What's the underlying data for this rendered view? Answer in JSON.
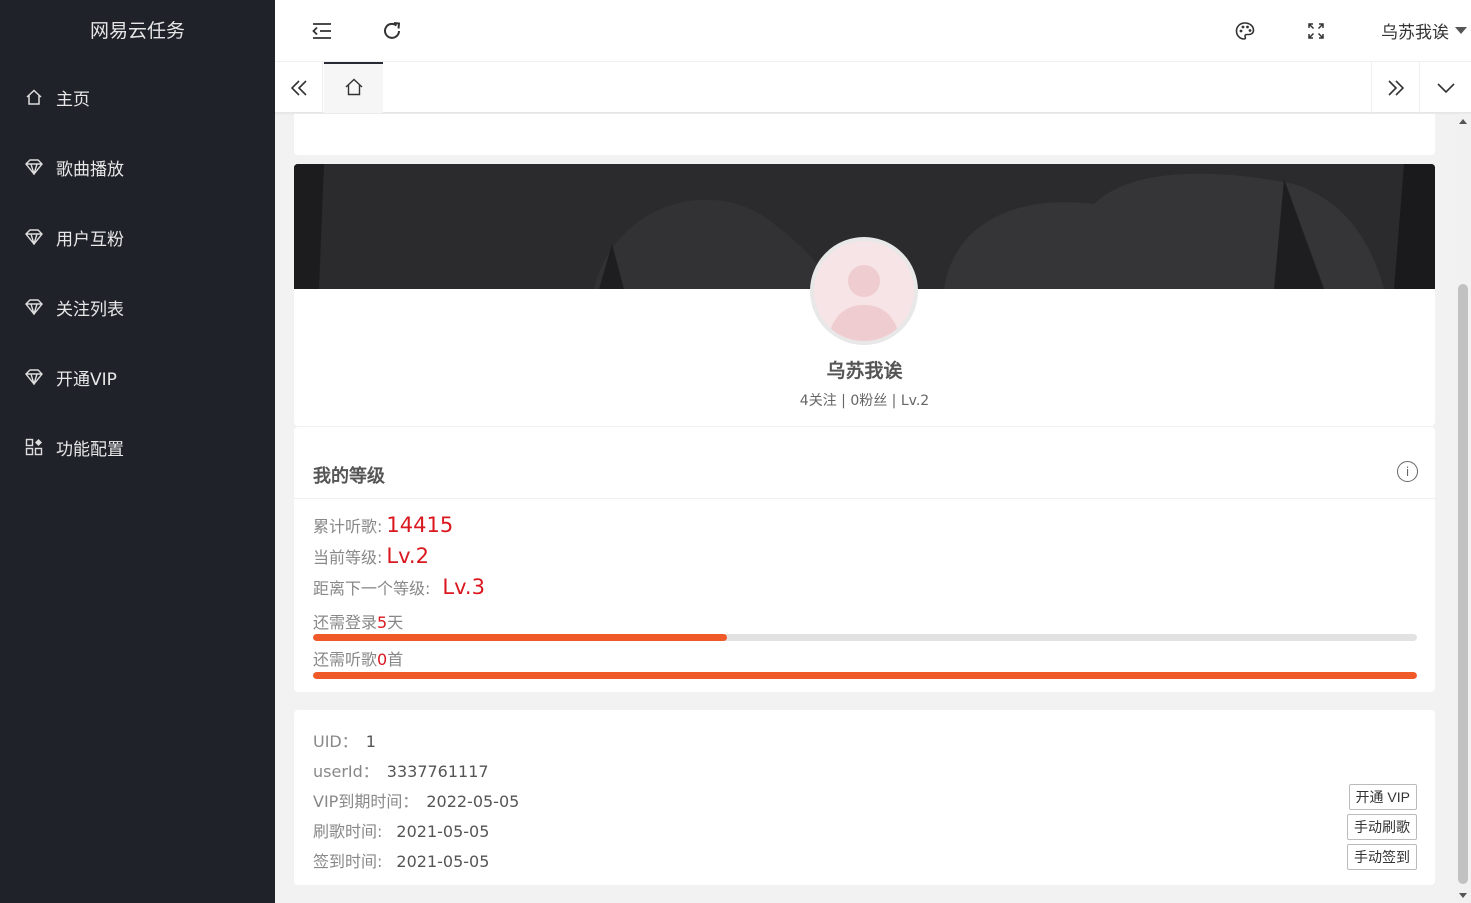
{
  "app": {
    "title": "网易云任务"
  },
  "sidebar": {
    "items": [
      {
        "label": "主页",
        "icon": "home-icon"
      },
      {
        "label": "歌曲播放",
        "icon": "diamond-icon"
      },
      {
        "label": "用户互粉",
        "icon": "diamond-icon"
      },
      {
        "label": "关注列表",
        "icon": "diamond-icon"
      },
      {
        "label": "开通VIP",
        "icon": "diamond-icon"
      },
      {
        "label": "功能配置",
        "icon": "apps-icon"
      }
    ]
  },
  "header": {
    "username": "乌苏我诶",
    "icons": [
      "menu-collapse-icon",
      "refresh-icon",
      "palette-icon",
      "fullscreen-icon"
    ]
  },
  "profile": {
    "name": "乌苏我诶",
    "stats": "4关注 | 0粉丝 | Lv.2"
  },
  "level": {
    "title": "我的等级",
    "total_label": "累计听歌:",
    "total_value": "14415",
    "current_label": "当前等级:",
    "current_value": "Lv.2",
    "next_label": "距离下一个等级:",
    "next_value": "Lv.3",
    "login_prefix": "还需登录",
    "login_days": "5",
    "login_suffix": "天",
    "login_progress": 0.375,
    "listen_prefix": "还需听歌",
    "listen_count": "0",
    "listen_suffix": "首",
    "listen_progress": 1.0
  },
  "detail": {
    "uid_label": "UID：",
    "uid_value": "1",
    "userid_label": "userId：",
    "userid_value": "3337761117",
    "vip_label": "VIP到期时间：",
    "vip_value": "2022-05-05",
    "refresh_label": "刷歌时间:",
    "refresh_value": "2021-05-05",
    "signin_label": "签到时间:",
    "signin_value": "2021-05-05",
    "btn_vip": "开通 VIP",
    "btn_refresh": "手动刷歌",
    "btn_signin": "手动签到"
  },
  "colors": {
    "sidebar": "#20222a",
    "accent": "#f05a28",
    "highlight": "#d9181f"
  }
}
